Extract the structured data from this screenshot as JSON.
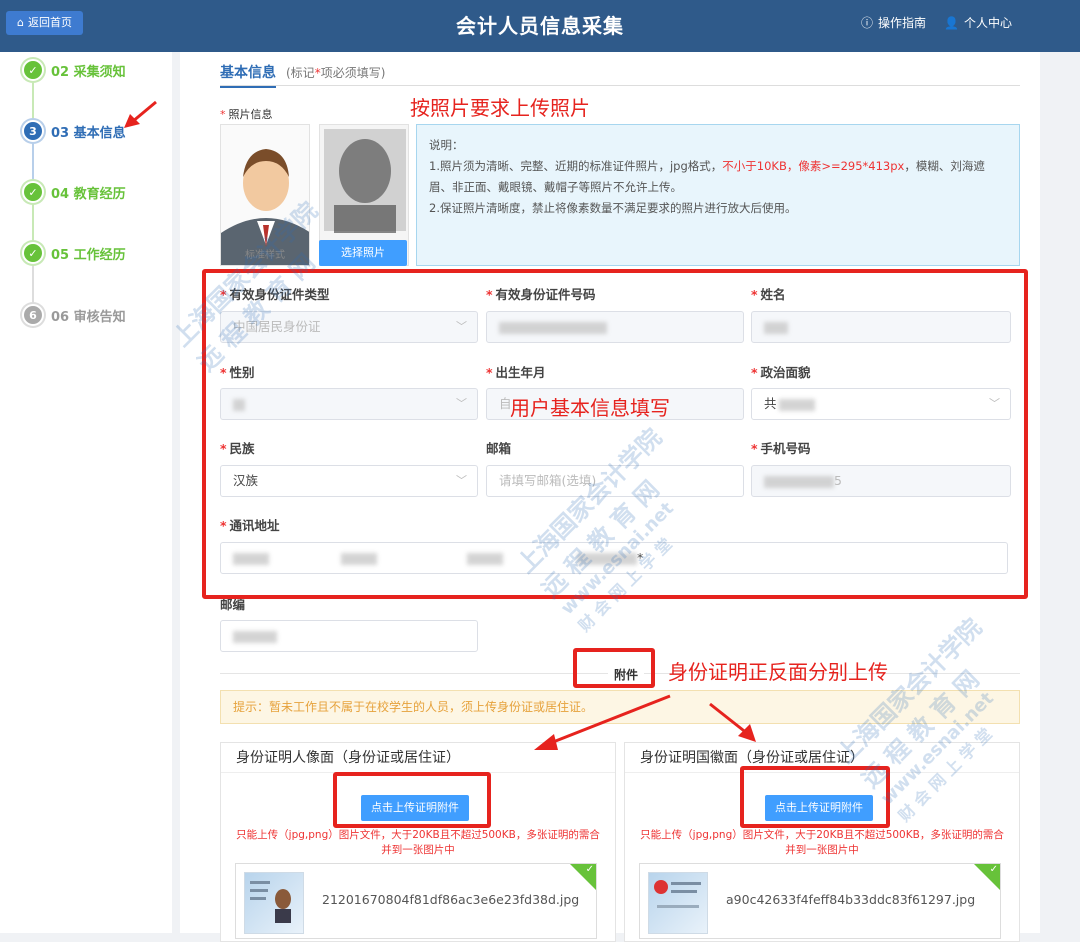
{
  "header": {
    "home_button": "返回首页",
    "title": "会计人员信息采集",
    "guide": "操作指南",
    "profile": "个人中心"
  },
  "steps": [
    {
      "num": "✓",
      "label": "02 采集须知",
      "state": "done"
    },
    {
      "num": "3",
      "label": "03 基本信息",
      "state": "current"
    },
    {
      "num": "✓",
      "label": "04 教育经历",
      "state": "done"
    },
    {
      "num": "✓",
      "label": "05 工作经历",
      "state": "done"
    },
    {
      "num": "6",
      "label": "06 审核告知",
      "state": "todo"
    }
  ],
  "tab": {
    "title": "基本信息",
    "note_prefix": "(标记",
    "note_star": "*",
    "note_suffix": "项必须填写)"
  },
  "photo": {
    "label": "照片信息",
    "sample_caption": "标准样式",
    "choose_button": "选择照片",
    "desc_title": "说明：",
    "desc_line1_a": "1.照片须为清晰、完整、近期的标准证件照片，jpg格式，",
    "desc_line1_red": "不小于10KB，像素>=295*413px",
    "desc_line1_b": "，模糊、刘海遮眉、非正面、戴眼镜、戴帽子等照片不允许上传。",
    "desc_line2": "2.保证照片清晰度，禁止将像素数量不满足要求的照片进行放大后使用。"
  },
  "annotations": {
    "photo_note": "按照片要求上传照片",
    "form_note": "用户基本信息填写",
    "id_note": "身份证明正反面分别上传"
  },
  "form": {
    "id_type_label": "有效身份证件类型",
    "id_type_value": "中国居民身份证",
    "id_number_label": "有效身份证件号码",
    "name_label": "姓名",
    "gender_label": "性别",
    "birth_label": "出生年月",
    "birth_placeholder": "自",
    "politics_label": "政治面貌",
    "politics_value": "共",
    "nation_label": "民族",
    "nation_value": "汉族",
    "email_label": "邮箱",
    "email_placeholder": "请填写邮箱(选填)",
    "phone_label": "手机号码",
    "phone_value": "5",
    "address_label": "通讯地址",
    "address_tail": "*",
    "zip_label": "邮编"
  },
  "attachments": {
    "section_title": "附件",
    "tip": "提示：暂未工作且不属于在校学生的人员，须上传身份证或居住证。",
    "cards": [
      {
        "title": "身份证明人像面（身份证或居住证）",
        "button": "点击上传证明附件",
        "hint": "只能上传（jpg,png）图片文件，大于20KB且不超过500KB，多张证明的需合并到一张图片中",
        "file": "21201670804f81df86ac3e6e23fd38d.jpg"
      },
      {
        "title": "身份证明国徽面（身份证或居住证）",
        "button": "点击上传证明附件",
        "hint": "只能上传（jpg,png）图片文件，大于20KB且不超过500KB，多张证明的需合并到一张图片中",
        "file": "a90c42633f4feff84b33ddc83f61297.jpg"
      }
    ]
  },
  "watermark": {
    "line1": "上海国家会计学院",
    "line2": "远 程 教 育 网",
    "line3": "www.esnai.net",
    "line4": "财 会 网 上 学 堂"
  },
  "colors": {
    "header_bg": "#2f5a8a",
    "primary": "#409eff",
    "success": "#67c23a",
    "annotation_red": "#e6231e",
    "required": "#e33"
  }
}
